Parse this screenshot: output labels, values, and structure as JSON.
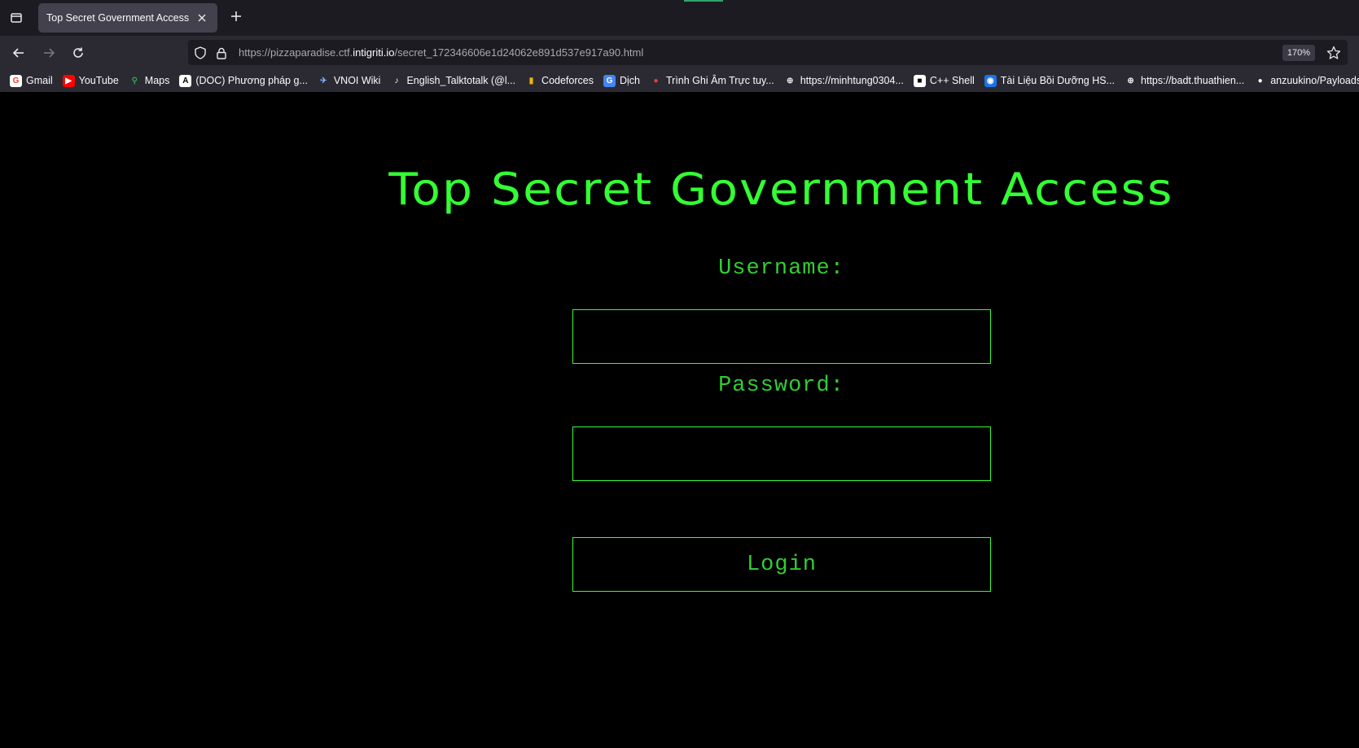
{
  "browser": {
    "tab": {
      "title": "Top Secret Government Access"
    },
    "url": {
      "prefix": "https://pizzaparadise.ctf.",
      "host": "intigriti.io",
      "path": "/secret_172346606e1d24062e891d537e917a90.html"
    },
    "zoom": "170%",
    "bookmarks": [
      {
        "label": "Gmail",
        "icon": "gmail-icon"
      },
      {
        "label": "YouTube",
        "icon": "youtube-icon"
      },
      {
        "label": "Maps",
        "icon": "maps-icon"
      },
      {
        "label": "(DOC) Phương pháp g...",
        "icon": "academia-icon"
      },
      {
        "label": "VNOI Wiki",
        "icon": "vnoi-icon"
      },
      {
        "label": "English_Talktotalk (@l...",
        "icon": "tiktok-icon"
      },
      {
        "label": "Codeforces",
        "icon": "codeforces-icon"
      },
      {
        "label": "Dịch",
        "icon": "translate-icon"
      },
      {
        "label": "Trình Ghi Âm Trực tuy...",
        "icon": "recorder-icon"
      },
      {
        "label": "https://minhtung0304...",
        "icon": "globe-icon"
      },
      {
        "label": "C++ Shell",
        "icon": "cpp-shell-icon"
      },
      {
        "label": "Tài Liệu Bồi Dưỡng HS...",
        "icon": "edu-icon"
      },
      {
        "label": "https://badt.thuathien...",
        "icon": "globe-icon"
      },
      {
        "label": "anzuukino/PayloadsAl...",
        "icon": "github-icon"
      }
    ]
  },
  "page": {
    "title": "Top Secret Government Access",
    "form": {
      "username_label": "Username:",
      "username_value": "",
      "password_label": "Password:",
      "password_value": "",
      "login_label": "Login"
    }
  },
  "colors": {
    "page_background": "#000000",
    "accent_green": "#33ff33",
    "label_green": "#33cc33"
  }
}
